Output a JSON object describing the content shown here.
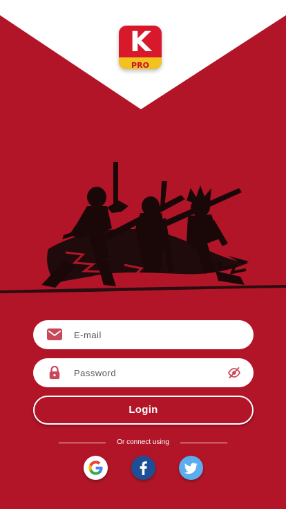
{
  "brand": {
    "logo_letter": "K",
    "logo_badge": "PRO"
  },
  "login_form": {
    "email_placeholder": "E-mail",
    "password_placeholder": "Password",
    "login_label": "Login"
  },
  "social_login": {
    "divider_text": "Or connect using",
    "providers": [
      "google",
      "facebook",
      "twitter"
    ]
  },
  "colors": {
    "background": "#b21528",
    "top_panel": "#ffffff",
    "input_icon": "#c8485a",
    "logo_badge": "#f4c21f"
  }
}
